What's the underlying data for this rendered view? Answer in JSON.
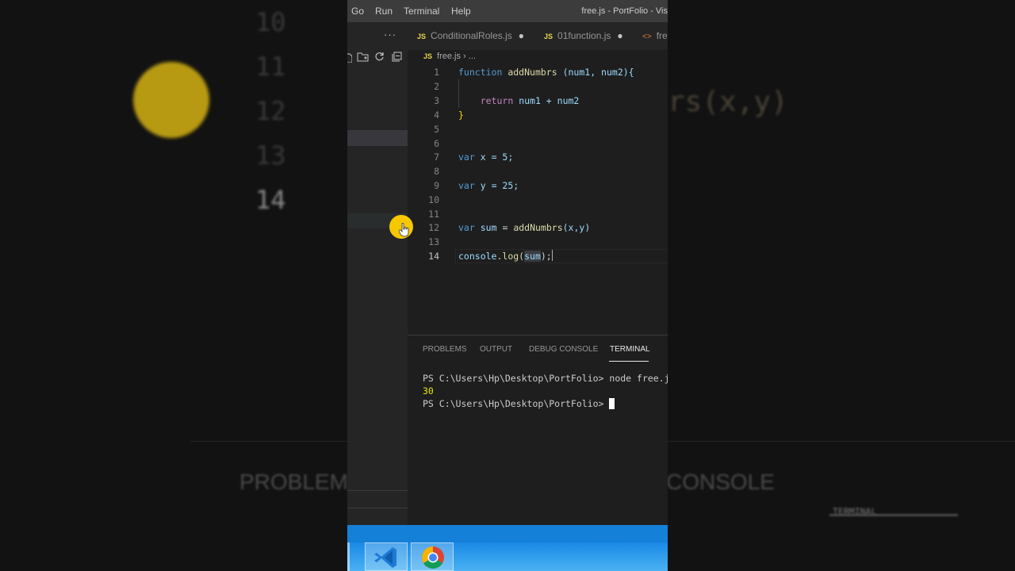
{
  "background": {
    "line_numbers": [
      "10",
      "11",
      "12",
      "13",
      "14"
    ],
    "code_fragment": "rs(x,y)",
    "panel_tabs": [
      "PROBLEMS",
      "CONSOLE",
      "TERMINAL"
    ]
  },
  "menubar": {
    "items": [
      "Go",
      "Run",
      "Terminal",
      "Help"
    ],
    "title": "free.js - PortFolio - Vis"
  },
  "sidebar": {
    "more_actions": "···"
  },
  "tabs": [
    {
      "icon": "JS",
      "label": "ConditionalRoles.js",
      "modified": "●"
    },
    {
      "icon": "JS",
      "label": "01function.js",
      "modified": "●"
    },
    {
      "icon": "<>",
      "label": "fre"
    }
  ],
  "breadcrumb": {
    "icon": "JS",
    "file": "free.js",
    "separator": "›",
    "rest": "..."
  },
  "editor": {
    "line_numbers": [
      "1",
      "2",
      "3",
      "4",
      "5",
      "6",
      "7",
      "8",
      "9",
      "10",
      "11",
      "12",
      "13",
      "14"
    ],
    "current_line": 14,
    "code": {
      "l1_kw": "function",
      "l1_fn": "addNumbrs",
      "l1_params": "(num1, num2){",
      "l3_kw": "return",
      "l3_expr": "num1 + num2",
      "l4": "}",
      "l7_kw": "var",
      "l7_rest": "x = 5;",
      "l9_kw": "var",
      "l9_rest": "y = 25;",
      "l12_kw": "var",
      "l12_var": "sum",
      "l12_eq": "=",
      "l12_fn": "addNumbrs",
      "l12_args": "(x,y)",
      "l14_obj": "console",
      "l14_fn": ".log(",
      "l14_arg": "sum",
      "l14_end": ");"
    }
  },
  "panel": {
    "tabs": [
      "PROBLEMS",
      "OUTPUT",
      "DEBUG CONSOLE",
      "TERMINAL"
    ],
    "active_tab": "TERMINAL",
    "terminal": {
      "line1": "PS C:\\Users\\Hp\\Desktop\\PortFolio> node free.js",
      "output": "30",
      "prompt": "PS C:\\Users\\Hp\\Desktop\\PortFolio> "
    }
  },
  "taskbar": {
    "apps": [
      "vscode-icon",
      "chrome-icon"
    ]
  },
  "colors": {
    "accent_pointer": "#f6c800",
    "taskbar": "#1a8ae6",
    "keyword": "#569cd6",
    "function": "#dcdcaa"
  }
}
